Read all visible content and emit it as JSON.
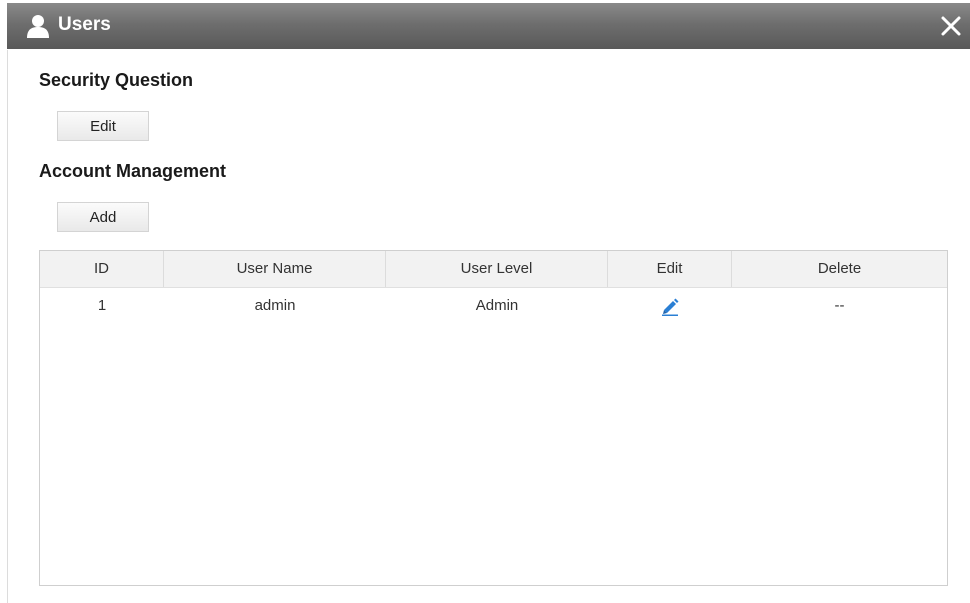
{
  "window": {
    "title": "Users",
    "title_icon": "user-icon",
    "close_icon": "close-icon"
  },
  "security_question": {
    "heading": "Security Question",
    "edit_label": "Edit"
  },
  "account_management": {
    "heading": "Account Management",
    "add_label": "Add"
  },
  "table": {
    "columns": [
      "ID",
      "User Name",
      "User Level",
      "Edit",
      "Delete"
    ],
    "rows": [
      {
        "id": "1",
        "user_name": "admin",
        "user_level": "Admin",
        "edit_icon": "pencil-icon",
        "delete": "--"
      }
    ]
  },
  "colors": {
    "titlebar": "#6e6e6e",
    "accent_icon": "#2a7fd4"
  }
}
